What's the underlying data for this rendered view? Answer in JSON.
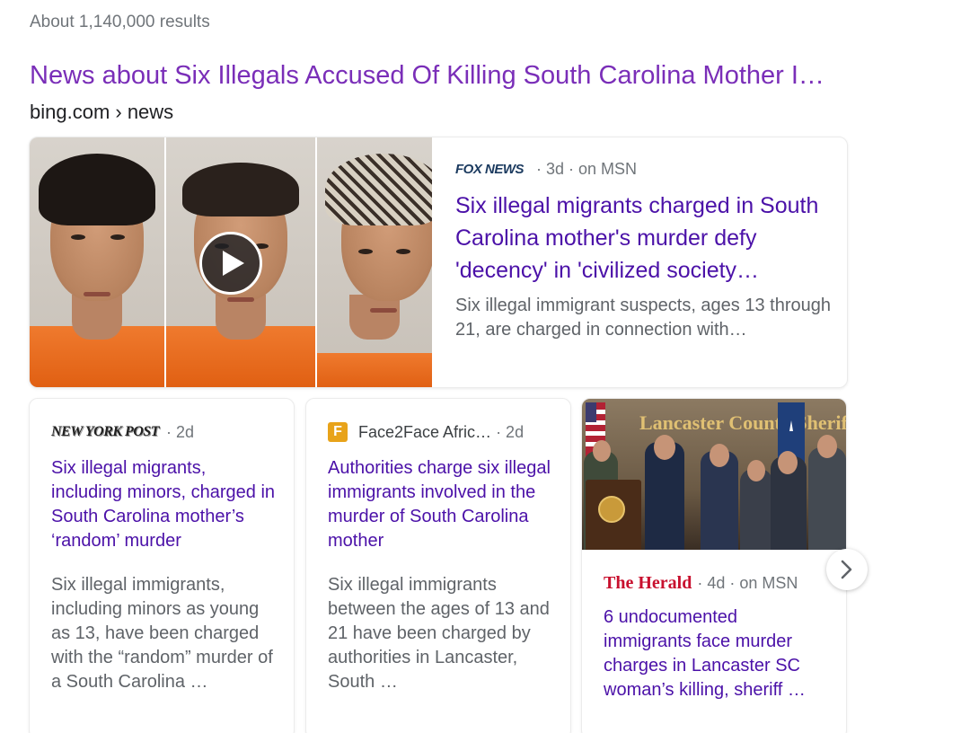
{
  "results": {
    "count_text": "About 1,140,000 results"
  },
  "news_section": {
    "title": "News about Six Illegals Accused Of Killing South Carolina Mother I…",
    "breadcrumb": "bing.com › news"
  },
  "top_story": {
    "source_logo_text": "FOX NEWS",
    "meta": "· 3d · on MSN",
    "headline": "Six illegal migrants charged in South Carolina mother's murder defy 'decency' in 'civilized society…",
    "snippet": "Six illegal immigrant suspects, ages 13 through 21, are charged in connection with…",
    "has_video": true
  },
  "cards": [
    {
      "source_logo_text": "NEW YORK POST",
      "meta": "· 2d",
      "headline": "Six illegal migrants, including minors, charged in South Carolina mother’s ‘random’ murder",
      "snippet": "Six illegal immigrants, including minors as young as 13, have been charged with the “random” murder of a South Carolina …"
    },
    {
      "source_icon_letter": "F",
      "source_name": "Face2Face Afric…",
      "meta": "· 2d",
      "headline": "Authorities charge six illegal immigrants involved in the murder of South Carolina mother",
      "snippet": "Six illegal immigrants between the ages of 13 and 21 have been charged by authorities in Lancaster, South …"
    },
    {
      "image_banner_text": "Lancaster County Sheriff's Office",
      "source_logo_text": "The Herald",
      "meta": "· 4d · on MSN",
      "headline": "6 undocumented immigrants face murder charges in Lancaster SC woman’s killing, sheriff …"
    }
  ],
  "colors": {
    "link_purple": "#4b11a8",
    "title_purple": "#7a2eb8",
    "meta_gray": "#70757a",
    "herald_red": "#c8102e",
    "face2face_orange": "#e8a31a"
  },
  "icons": {
    "play": "play-icon",
    "next": "chevron-right-icon"
  }
}
